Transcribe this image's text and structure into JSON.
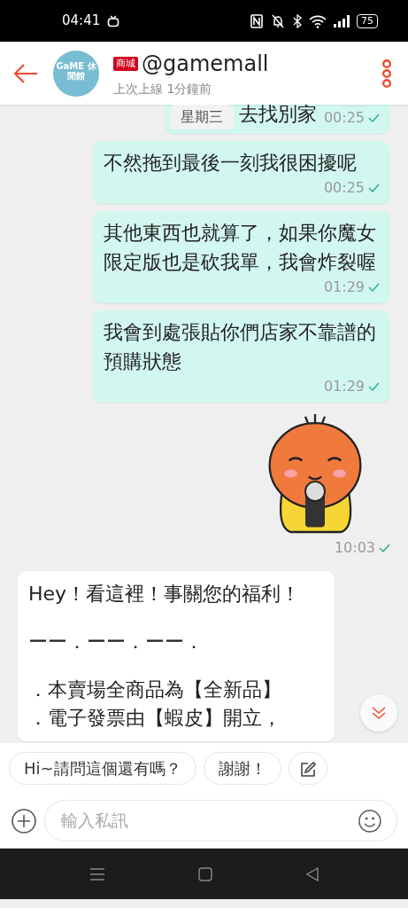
{
  "status_bar": {
    "time": "04:41",
    "battery": "75"
  },
  "header": {
    "badge": "商城",
    "name": "@gamemall",
    "subtitle": "上次上線 1分鐘前",
    "avatar_text": "GaME 休閒館"
  },
  "date_chip": "星期三",
  "messages": [
    {
      "kind": "text",
      "outgoing": true,
      "paragraphs": [
        [
          "去找別家"
        ]
      ],
      "time": "00:25",
      "read": true,
      "cut": true
    },
    {
      "kind": "text",
      "outgoing": true,
      "paragraphs": [
        [
          "不然拖到最後一刻我很困擾呢"
        ]
      ],
      "time": "00:25",
      "read": true
    },
    {
      "kind": "text",
      "outgoing": true,
      "paragraphs": [
        [
          "其他東西也就算了，如果你魔女限定版也是砍我單，我會炸裂喔"
        ]
      ],
      "time": "01:29",
      "read": true
    },
    {
      "kind": "text",
      "outgoing": true,
      "paragraphs": [
        [
          "我會到處張貼你們店家不靠譜的預購狀態"
        ]
      ],
      "time": "01:29",
      "read": true
    },
    {
      "kind": "sticker",
      "outgoing": true,
      "time": "10:03",
      "read": true
    },
    {
      "kind": "text",
      "outgoing": false,
      "paragraphs": [
        [
          "Hey！看這裡！事關您的福利！"
        ],
        [
          "ーー．ーー．ーー．"
        ],
        [
          "．本賣場全商品為【全新品】",
          "．電子發票由【蝦皮】開立，"
        ]
      ]
    }
  ],
  "quick_replies": [
    "Hi~請問這個還有嗎？",
    "謝謝！"
  ],
  "input": {
    "placeholder": "輸入私訊"
  }
}
